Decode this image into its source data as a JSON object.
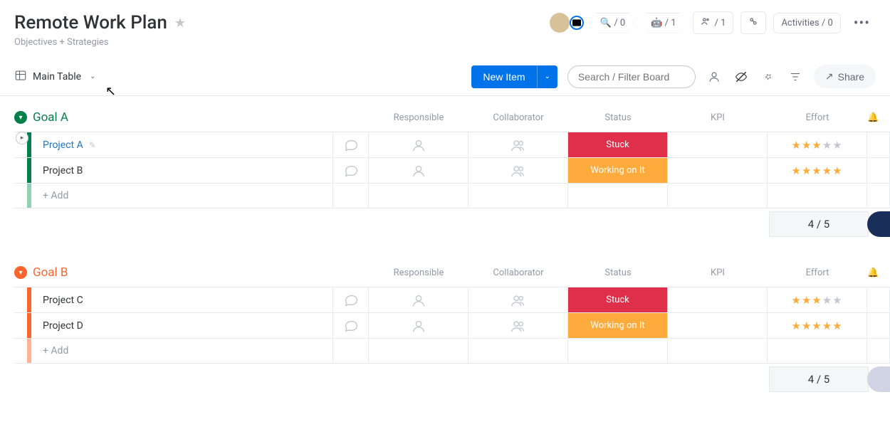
{
  "header": {
    "title": "Remote Work Plan",
    "subtitle": "Objectives + Strategies"
  },
  "toolbar": {
    "integration_count": "/ 0",
    "automation_count": "/ 1",
    "members_count": "/ 1",
    "activities_label": "Activities / 0"
  },
  "view": {
    "main_table": "Main Table",
    "new_item": "New Item",
    "search_placeholder": "Search / Filter Board",
    "share": "Share"
  },
  "columns": {
    "responsible": "Responsible",
    "collaborator": "Collaborator",
    "status": "Status",
    "kpi": "KPI",
    "effort": "Effort"
  },
  "groups": [
    {
      "name": "Goal A",
      "color": "#037f4c",
      "rows": [
        {
          "name": "Project A",
          "link": true,
          "status": "Stuck",
          "status_class": "stuck",
          "effort": 3
        },
        {
          "name": "Project B",
          "link": false,
          "status": "Working on It",
          "status_class": "working",
          "effort": 5
        }
      ],
      "add": "+ Add",
      "effort_summary": "4 / 5"
    },
    {
      "name": "Goal B",
      "color": "#ff642e",
      "rows": [
        {
          "name": "Project C",
          "link": false,
          "status": "Stuck",
          "status_class": "stuck",
          "effort": 3
        },
        {
          "name": "Project D",
          "link": false,
          "status": "Working on It",
          "status_class": "working",
          "effort": 5
        }
      ],
      "add": "+ Add",
      "effort_summary": "4 / 5"
    }
  ]
}
